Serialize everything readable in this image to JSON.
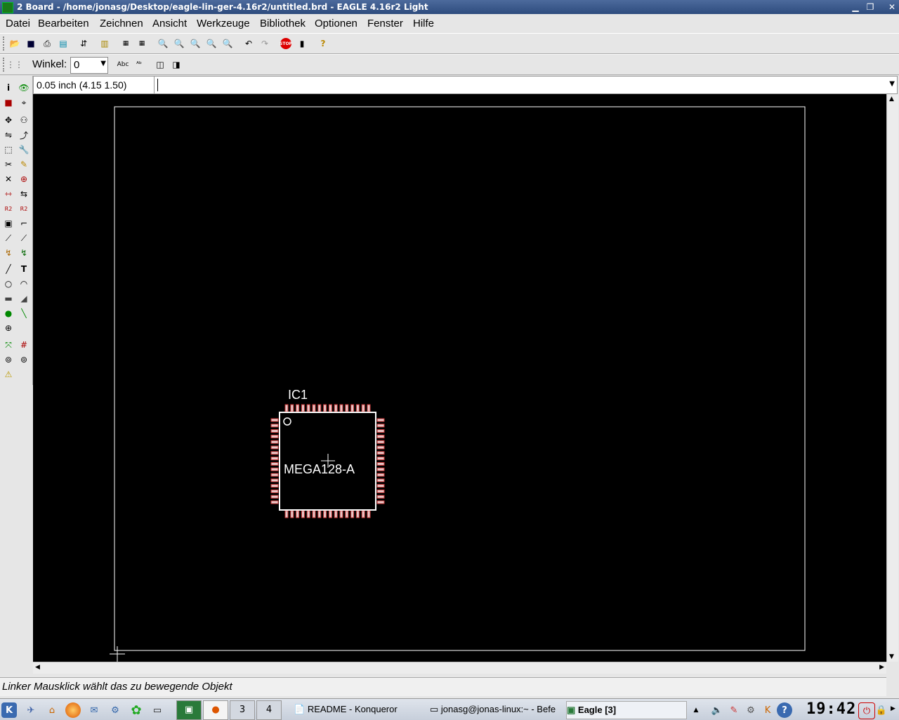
{
  "window": {
    "title": "2 Board - /home/jonasg/Desktop/eagle-lin-ger-4.16r2/untitled.brd - EAGLE 4.16r2 Light"
  },
  "menu": [
    "Datei",
    "Bearbeiten",
    "Zeichnen",
    "Ansicht",
    "Werkzeuge",
    "Bibliothek",
    "Optionen",
    "Fenster",
    "Hilfe"
  ],
  "params": {
    "angle_label": "Winkel:",
    "angle_value": "0"
  },
  "coords": "0.05 inch (4.15 1.50)",
  "command_input": "",
  "board": {
    "part_name": "IC1",
    "part_value": "MEGA128-A"
  },
  "status": "Linker Mausklick wählt das zu bewegende Objekt",
  "taskbar": {
    "desk3": "3",
    "desk4": "4",
    "task_konqueror": "README - Konqueror",
    "task_terminal": "jonasg@jonas-linux:~ - Befe",
    "task_eagle": "Eagle [3]",
    "clock": "19:42"
  },
  "colors": {
    "canvas": "#000000",
    "pad": "#c83232",
    "outline": "#ffffff",
    "titlebar": "#3a5a8c"
  }
}
